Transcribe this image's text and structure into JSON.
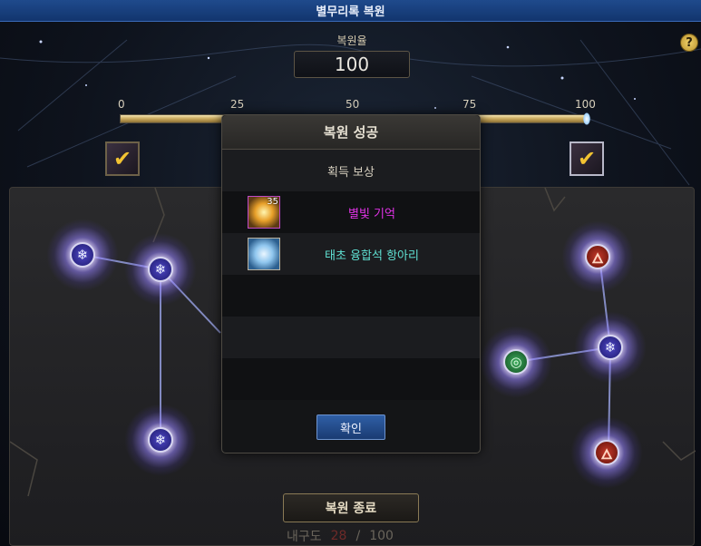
{
  "window": {
    "title": "별무리록 복원"
  },
  "rate": {
    "label": "복원율",
    "value": "100"
  },
  "progress": {
    "ticks": [
      "0",
      "25",
      "50",
      "75",
      "100"
    ],
    "percent": 100
  },
  "popup": {
    "title": "복원 성공",
    "subtitle": "획득 보상",
    "rewards": [
      {
        "name": "별빛 기억",
        "qty": "35",
        "icon": "starlight-icon",
        "color": "#e233e8"
      },
      {
        "name": "태초 융합석 항아리",
        "qty": "",
        "icon": "fusion-vase-icon",
        "color": "#5fe0d2"
      }
    ],
    "confirm": "확인"
  },
  "footer": {
    "end_button": "복원 종료",
    "durability_label": "내구도",
    "durability_current": "28",
    "durability_sep": "/",
    "durability_max": "100"
  },
  "help": {
    "glyph": "?"
  },
  "nodes": {
    "ice_glyph": "❄",
    "fire_glyph": "🜂",
    "wind_glyph": "◎"
  },
  "colors": {
    "title_bar": "#1f4a8c",
    "accent_gold": "#c9a85c",
    "item_magenta": "#e233e8",
    "item_teal": "#5fe0d2"
  }
}
